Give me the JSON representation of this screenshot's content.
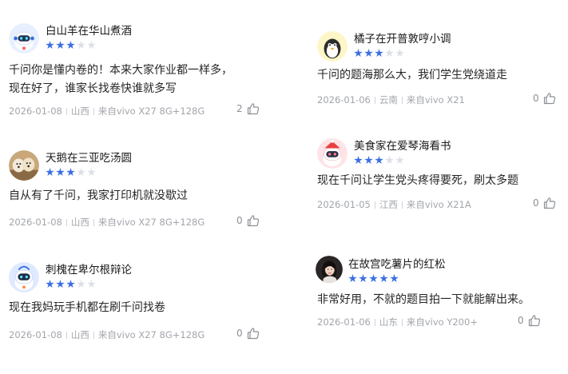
{
  "reviews": [
    {
      "username": "白山羊在华山煮酒",
      "rating": 3,
      "text_lines": [
        "千问你是懂内卷的！本来大家作业都一样多，",
        "现在好了，谁家长找卷快谁就多写"
      ],
      "date": "2026-01-08",
      "region": "山西",
      "device": "来自vivo X27 8G+128G",
      "likes": "2",
      "avatar_icon": "robot-avatar-icon",
      "avatar_bg": "#e8f0ff"
    },
    {
      "username": "天鹅在三亚吃汤圆",
      "rating": 3,
      "text_lines": [
        "自从有了千问，我家打印机就没歇过"
      ],
      "date": "2026-01-08",
      "region": "山西",
      "device": "来自vivo X27 8G+128G",
      "likes": "0",
      "avatar_icon": "dogs-photo-avatar-icon",
      "avatar_bg": "#c9a77a"
    },
    {
      "username": "刺槐在卑尔根辩论",
      "rating": 3,
      "text_lines": [
        "现在我妈玩手机都在刷千问找卷"
      ],
      "date": "2026-01-08",
      "region": "山西",
      "device": "来自vivo X27 8G+128G",
      "likes": "0",
      "avatar_icon": "robot-avatar-icon",
      "avatar_bg": "#dfe9ff"
    },
    {
      "username": "橘子在开普敦哼小调",
      "rating": 3,
      "text_lines": [
        "千问的题海那么大，我们学生党绕道走"
      ],
      "date": "2026-01-06",
      "region": "云南",
      "device": "来自vivo X21",
      "likes": "0",
      "avatar_icon": "penguin-avatar-icon",
      "avatar_bg": "#fff6c8"
    },
    {
      "username": "美食家在爱琴海看书",
      "rating": 3,
      "text_lines": [
        "现在千问让学生党头疼得要死，刷太多题"
      ],
      "date": "2026-01-05",
      "region": "江西",
      "device": "来自vivo X21A",
      "likes": "0",
      "avatar_icon": "robot-hat-avatar-icon",
      "avatar_bg": "#ffe3e6"
    },
    {
      "username": "在故宫吃薯片的红松",
      "rating": 5,
      "text_lines": [
        "非常好用，不就的题目拍一下就能解出来。"
      ],
      "date": "2026-01-06",
      "region": "山东",
      "device": "来自vivo Y200+",
      "likes": "0",
      "avatar_icon": "woman-photo-avatar-icon",
      "avatar_bg": "#2b2626"
    }
  ],
  "colors": {
    "star_on": "#3a6fe3",
    "star_off": "#dcdfe6",
    "meta_text": "#a2a5ab"
  }
}
